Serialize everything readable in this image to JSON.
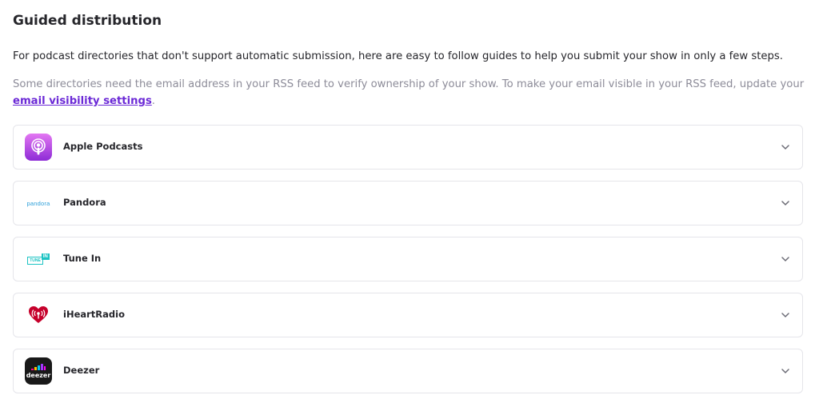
{
  "section": {
    "title": "Guided distribution",
    "intro": "For podcast directories that don't support automatic submission, here are easy to follow guides to help you submit your show in only a few steps.",
    "note_prefix": "Some directories need the email address in your RSS feed to verify ownership of your show. To make your email visible in your RSS feed, update your ",
    "note_link": "email visibility settings",
    "note_suffix": "."
  },
  "directories": [
    {
      "name": "Apple Podcasts",
      "icon": "apple-podcasts-icon"
    },
    {
      "name": "Pandora",
      "icon": "pandora-logo",
      "logo_text": "pandora"
    },
    {
      "name": "Tune In",
      "icon": "tunein-logo",
      "logo_tune": "TUNE",
      "logo_in": "IN"
    },
    {
      "name": "iHeartRadio",
      "icon": "iheartradio-logo"
    },
    {
      "name": "Deezer",
      "icon": "deezer-logo",
      "logo_text": "deezer"
    }
  ],
  "colors": {
    "link": "#6b29d6",
    "muted_text": "#8d8c99",
    "border": "#e5e5ea",
    "iheart_red": "#c6002b",
    "tunein_teal": "#1cc3c3",
    "pandora_blue": "#2d9fd9"
  }
}
